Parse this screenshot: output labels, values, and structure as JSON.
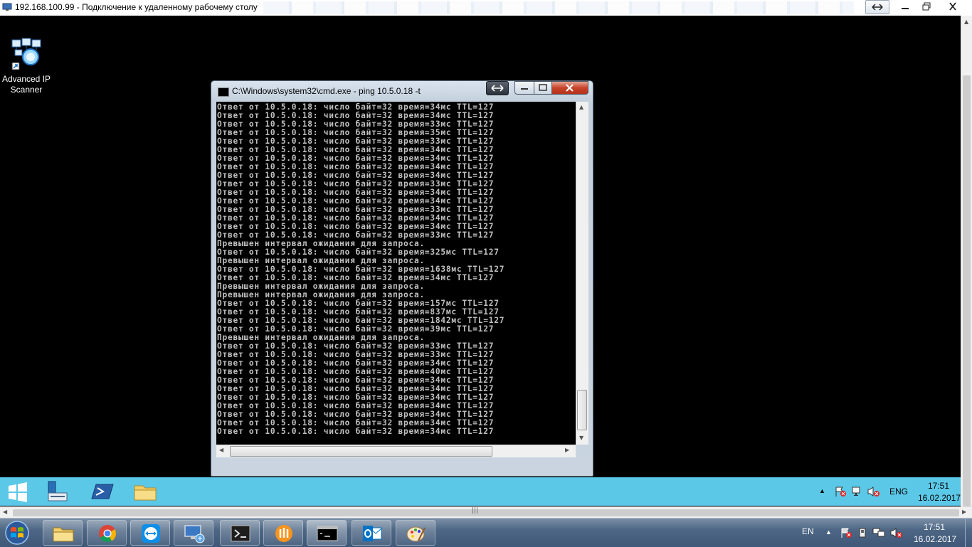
{
  "rdp": {
    "title": "192.168.100.99 - Подключение к удаленному рабочему столу"
  },
  "desktop": {
    "icons": [
      {
        "label": "Advanced IP Scanner",
        "icon": "network-scanner-icon"
      }
    ]
  },
  "cmd": {
    "title": "C:\\Windows\\system32\\cmd.exe - ping  10.5.0.18 -t",
    "lines": [
      "Ответ от 10.5.0.18: число байт=32 время=34мс TTL=127",
      "Ответ от 10.5.0.18: число байт=32 время=34мс TTL=127",
      "Ответ от 10.5.0.18: число байт=32 время=33мс TTL=127",
      "Ответ от 10.5.0.18: число байт=32 время=35мс TTL=127",
      "Ответ от 10.5.0.18: число байт=32 время=33мс TTL=127",
      "Ответ от 10.5.0.18: число байт=32 время=34мс TTL=127",
      "Ответ от 10.5.0.18: число байт=32 время=34мс TTL=127",
      "Ответ от 10.5.0.18: число байт=32 время=34мс TTL=127",
      "Ответ от 10.5.0.18: число байт=32 время=34мс TTL=127",
      "Ответ от 10.5.0.18: число байт=32 время=33мс TTL=127",
      "Ответ от 10.5.0.18: число байт=32 время=34мс TTL=127",
      "Ответ от 10.5.0.18: число байт=32 время=34мс TTL=127",
      "Ответ от 10.5.0.18: число байт=32 время=33мс TTL=127",
      "Ответ от 10.5.0.18: число байт=32 время=34мс TTL=127",
      "Ответ от 10.5.0.18: число байт=32 время=34мс TTL=127",
      "Ответ от 10.5.0.18: число байт=32 время=33мс TTL=127",
      "Превышен интервал ожидания для запроса.",
      "Ответ от 10.5.0.18: число байт=32 время=325мс TTL=127",
      "Превышен интервал ожидания для запроса.",
      "Ответ от 10.5.0.18: число байт=32 время=1638мс TTL=127",
      "Ответ от 10.5.0.18: число байт=32 время=34мс TTL=127",
      "Превышен интервал ожидания для запроса.",
      "Превышен интервал ожидания для запроса.",
      "Ответ от 10.5.0.18: число байт=32 время=157мс TTL=127",
      "Ответ от 10.5.0.18: число байт=32 время=837мс TTL=127",
      "Ответ от 10.5.0.18: число байт=32 время=1842мс TTL=127",
      "Ответ от 10.5.0.18: число байт=32 время=39мс TTL=127",
      "Превышен интервал ожидания для запроса.",
      "Ответ от 10.5.0.18: число байт=32 время=33мс TTL=127",
      "Ответ от 10.5.0.18: число байт=32 время=33мс TTL=127",
      "Ответ от 10.5.0.18: число байт=32 время=34мс TTL=127",
      "Ответ от 10.5.0.18: число байт=32 время=40мс TTL=127",
      "Ответ от 10.5.0.18: число байт=32 время=34мс TTL=127",
      "Ответ от 10.5.0.18: число байт=32 время=34мс TTL=127",
      "Ответ от 10.5.0.18: число байт=32 время=34мс TTL=127",
      "Ответ от 10.5.0.18: число байт=32 время=34мс TTL=127",
      "Ответ от 10.5.0.18: число байт=32 время=34мс TTL=127",
      "Ответ от 10.5.0.18: число байт=32 время=34мс TTL=127",
      "Ответ от 10.5.0.18: число байт=32 время=34мс TTL=127"
    ]
  },
  "remote_taskbar": {
    "language": "ENG",
    "time": "17:51",
    "date": "16.02.2017",
    "pinned": [
      "windows-logo-icon",
      "server-manager-icon",
      "powershell-icon",
      "file-explorer-icon"
    ]
  },
  "local_taskbar": {
    "language": "EN",
    "time": "17:51",
    "date": "16.02.2017",
    "pinned": [
      "file-explorer-icon",
      "chrome-icon",
      "teamviewer-icon",
      "remote-desktop-icon",
      "powershell-icon",
      "app-orange-icon",
      "cmd-icon",
      "outlook-icon",
      "paint-icon"
    ]
  },
  "colors": {
    "remote_taskbar_bg": "#5cc8e8",
    "console_text": "#c0c0c0",
    "console_bg": "#000000"
  }
}
